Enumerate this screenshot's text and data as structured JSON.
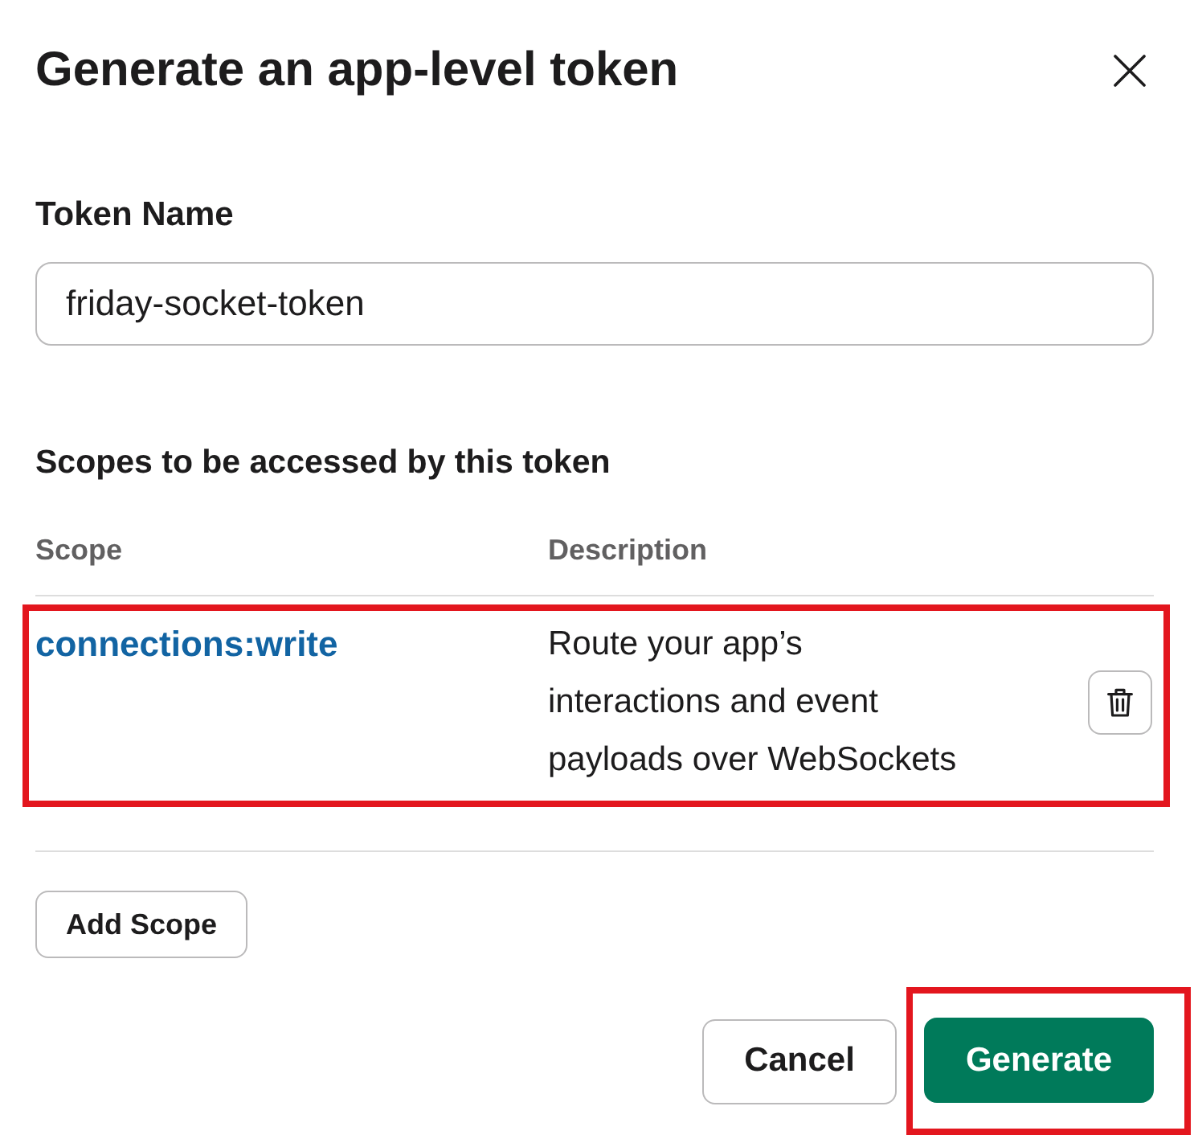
{
  "dialog": {
    "title": "Generate an app-level token"
  },
  "token_name": {
    "label": "Token Name",
    "value": "friday-socket-token"
  },
  "scopes": {
    "heading": "Scopes to be accessed by this token",
    "columns": [
      "Scope",
      "Description"
    ],
    "rows": [
      {
        "scope": "connections:write",
        "description": "Route your app’s interactions and event payloads over WebSockets",
        "highlighted": true
      }
    ]
  },
  "add_scope_button": "Add Scope",
  "buttons": [
    {
      "label": "Cancel",
      "kind": "secondary",
      "highlighted": false
    },
    {
      "label": "Generate",
      "kind": "primary",
      "highlighted": true
    }
  ]
}
